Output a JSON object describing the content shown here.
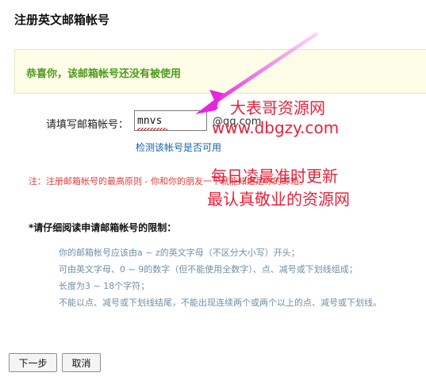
{
  "header": {
    "title": "注册英文邮箱帐号"
  },
  "notice": {
    "text": "恭喜你，该邮箱帐号还没有被使用"
  },
  "form": {
    "field_label": "请填写邮箱帐号：",
    "email_value": "mnvs",
    "domain_suffix": "@qq.com",
    "check_link": "检测该帐号是否可用"
  },
  "note": "注：注册邮箱帐号的最高原则 - 你和你的朋友一下就能知道是你的邮箱。",
  "restrictions": {
    "title": "*请仔细阅读申请邮箱帐号的限制：",
    "rules": [
      "你的邮箱帐号应该由a ~ z的英文字母（不区分大小写）开头；",
      "可由英文字母、0 ~ 9的数字（但不能使用全数字）、点、减号或下划线组成；",
      "长度为3 ~ 18个字符；",
      "不能以点、减号或下划线结尾，不能出现连续两个或两个以上的点、减号或下划线。"
    ]
  },
  "buttons": {
    "next": "下一步",
    "cancel": "取消"
  },
  "watermark": {
    "line1": "大表哥资源网",
    "line2": "www.dbgzy.com",
    "line3": "每日凌晨准时更新",
    "line4": "最认真敬业的资源网"
  },
  "colors": {
    "notice_text": "#4d9a1a",
    "notice_bg": "#fdfde8",
    "link": "#1a5fa8",
    "note_text": "#e83b3b",
    "rule_text": "#6f8fa6",
    "watermark": "#e8213a",
    "arrow": "#e526e0"
  },
  "icons": {
    "arrow": "annotation-arrow-icon"
  }
}
